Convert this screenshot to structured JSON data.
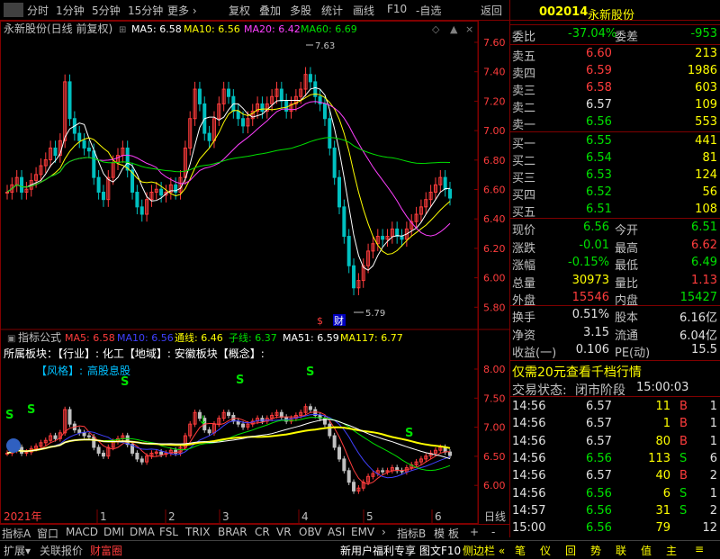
{
  "toolbar": {
    "items": [
      "分时",
      "1分钟",
      "5分钟",
      "15分钟",
      "更多 ›",
      "复权",
      "叠加",
      "多股",
      "统计",
      "画线",
      "F10",
      "-自选",
      "返回"
    ]
  },
  "header": {
    "stock_name_line": "永新股份(日线 前复权)",
    "ma_labels": [
      {
        "text": "MA5: 6.58",
        "color": "#ffffff"
      },
      {
        "text": "MA10: 6.56",
        "color": "#ffff00"
      },
      {
        "text": "MA20: 6.42",
        "color": "#ff40ff"
      },
      {
        "text": "MA60: 6.69",
        "color": "#00e000"
      }
    ]
  },
  "main_axis": {
    "ticks": [
      "7.60",
      "7.40",
      "7.20",
      "7.00",
      "6.80",
      "6.60",
      "6.40",
      "6.20",
      "6.00",
      "5.80"
    ]
  },
  "main_annotations": {
    "high": "7.63",
    "low": "5.79",
    "cai": "财",
    "dollar": "$"
  },
  "indicator": {
    "title": "指标公式",
    "labels": [
      {
        "text": "MA5: 6.58",
        "color": "#ff3c3c"
      },
      {
        "text": "MA10: 6.56",
        "color": "#4040ff"
      },
      {
        "text": "通线: 6.46",
        "color": "#ffff00"
      },
      {
        "text": "子线: 6.37",
        "color": "#00e000"
      },
      {
        "text": "MA51: 6.59",
        "color": "#ffffff"
      },
      {
        "text": "MA117: 6.77",
        "color": "#ffff00"
      }
    ],
    "sector_line": "所属板块：【行业】: 化工【地域】: 安徽板块【概念】:",
    "style_label": "【风格】: ",
    "style_value": "高股息股",
    "axis": [
      "8.00",
      "7.50",
      "7.00",
      "6.50",
      "6.00"
    ],
    "s_marks": [
      "S",
      "S",
      "S",
      "S",
      "S",
      "S"
    ]
  },
  "time_axis": {
    "year": "2021年",
    "months": [
      "1",
      "2",
      "3",
      "4",
      "5",
      "6"
    ],
    "period": "日线"
  },
  "bottom_tabs": [
    "指标A",
    "窗口",
    "MACD",
    "DMI",
    "DMA",
    "FSL",
    "TRIX",
    "BRAR",
    "CR",
    "VR",
    "OBV",
    "ASI",
    "EMV",
    "›",
    "指标B",
    "模",
    "板",
    "+",
    "-"
  ],
  "status_bar": {
    "left": [
      "扩展▾",
      "关联报价",
      "财富圈"
    ],
    "right_text": "新用户福利专享",
    "right_btns": [
      "图文F10",
      "侧边栏 «",
      "笔",
      "仪",
      "回",
      "势",
      "联",
      "值",
      "主",
      "≡"
    ]
  },
  "quote": {
    "code": "002014",
    "name": "永新股份",
    "weibi_label": "委比",
    "weibi_val": "-37.04%",
    "weicha_label": "委差",
    "weicha_val": "-953",
    "asks": [
      {
        "label": "卖五",
        "price": "6.60",
        "vol": "213"
      },
      {
        "label": "卖四",
        "price": "6.59",
        "vol": "1986"
      },
      {
        "label": "卖三",
        "price": "6.58",
        "vol": "603"
      },
      {
        "label": "卖二",
        "price": "6.57",
        "vol": "109"
      },
      {
        "label": "卖一",
        "price": "6.56",
        "vol": "553"
      }
    ],
    "bids": [
      {
        "label": "买一",
        "price": "6.55",
        "vol": "441"
      },
      {
        "label": "买二",
        "price": "6.54",
        "vol": "81"
      },
      {
        "label": "买三",
        "price": "6.53",
        "vol": "124"
      },
      {
        "label": "买四",
        "price": "6.52",
        "vol": "56"
      },
      {
        "label": "买五",
        "price": "6.51",
        "vol": "108"
      }
    ],
    "stats": [
      {
        "l1": "现价",
        "v1": "6.56",
        "c1": "green",
        "l2": "今开",
        "v2": "6.51",
        "c2": "green"
      },
      {
        "l1": "涨跌",
        "v1": "-0.01",
        "c1": "green",
        "l2": "最高",
        "v2": "6.62",
        "c2": "red"
      },
      {
        "l1": "涨幅",
        "v1": "-0.15%",
        "c1": "green",
        "l2": "最低",
        "v2": "6.49",
        "c2": "green"
      },
      {
        "l1": "总量",
        "v1": "30973",
        "c1": "yellow",
        "l2": "量比",
        "v2": "1.13",
        "c2": "red"
      },
      {
        "l1": "外盘",
        "v1": "15546",
        "c1": "red",
        "l2": "内盘",
        "v2": "15427",
        "c2": "green"
      }
    ],
    "stats2": [
      {
        "l1": "换手",
        "v1": "0.51%",
        "l2": "股本",
        "v2": "6.16亿"
      },
      {
        "l1": "净资",
        "v1": "3.15",
        "l2": "流通",
        "v2": "6.04亿"
      },
      {
        "l1": "收益(一)",
        "v1": "0.106",
        "l2": "PE(动)",
        "v2": "15.5"
      }
    ],
    "promo": "仅需20元查看千档行情",
    "trade_status_label": "交易状态:",
    "trade_status_value": "闭市阶段",
    "trade_status_time": "15:00:03",
    "ticks": [
      {
        "t": "14:56",
        "p": "6.57",
        "pc": "white",
        "v": "11",
        "side": "B",
        "n": "1"
      },
      {
        "t": "14:56",
        "p": "6.57",
        "pc": "white",
        "v": "1",
        "side": "B",
        "n": "1"
      },
      {
        "t": "14:56",
        "p": "6.57",
        "pc": "white",
        "v": "80",
        "side": "B",
        "n": "1"
      },
      {
        "t": "14:56",
        "p": "6.56",
        "pc": "green",
        "v": "113",
        "side": "S",
        "n": "6"
      },
      {
        "t": "14:56",
        "p": "6.57",
        "pc": "white",
        "v": "40",
        "side": "B",
        "n": "2"
      },
      {
        "t": "14:56",
        "p": "6.56",
        "pc": "green",
        "v": "6",
        "side": "S",
        "n": "1"
      },
      {
        "t": "14:57",
        "p": "6.56",
        "pc": "green",
        "v": "31",
        "side": "S",
        "n": "2"
      },
      {
        "t": "15:00",
        "p": "6.56",
        "pc": "green",
        "v": "79",
        "side": "",
        "n": "12"
      }
    ]
  }
}
